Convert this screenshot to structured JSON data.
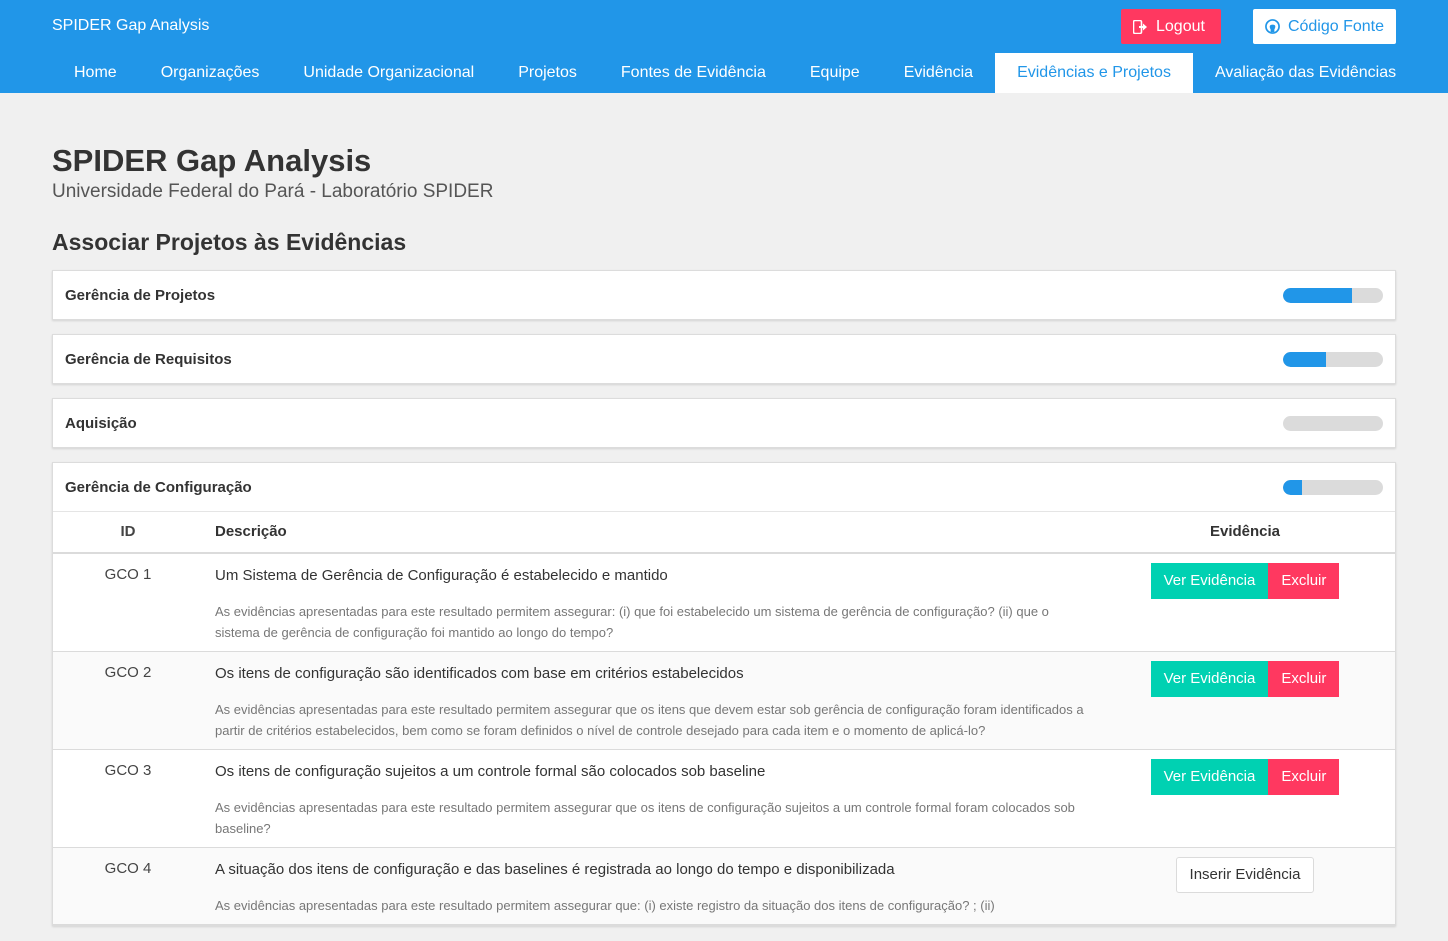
{
  "app": {
    "brand": "SPIDER Gap Analysis"
  },
  "header": {
    "logout_label": "Logout",
    "source_label": "Código Fonte"
  },
  "nav": {
    "tabs": [
      {
        "label": "Home"
      },
      {
        "label": "Organizações"
      },
      {
        "label": "Unidade Organizacional"
      },
      {
        "label": "Projetos"
      },
      {
        "label": "Fontes de Evidência"
      },
      {
        "label": "Equipe"
      },
      {
        "label": "Evidência"
      },
      {
        "label": "Evidências e Projetos",
        "active": true
      },
      {
        "label": "Avaliação das Evidências"
      }
    ]
  },
  "page": {
    "title": "SPIDER Gap Analysis",
    "subtitle": "Universidade Federal do Pará - Laboratório SPIDER",
    "section_title": "Associar Projetos às Evidências"
  },
  "panels": [
    {
      "title": "Gerência de Projetos",
      "progress": 0.69
    },
    {
      "title": "Gerência de Requisitos",
      "progress": 0.43
    },
    {
      "title": "Aquisição",
      "progress": 0.0
    },
    {
      "title": "Gerência de Configuração",
      "progress": 0.19
    }
  ],
  "table": {
    "headers": {
      "id": "ID",
      "description": "Descrição",
      "evidence": "Evidência"
    },
    "buttons": {
      "ver": "Ver Evidência",
      "excluir": "Excluir",
      "inserir": "Inserir Evidência"
    },
    "rows": [
      {
        "id": "GCO 1",
        "title": "Um Sistema de Gerência de Configuração é estabelecido e mantido",
        "text": "As evidências apresentadas para este resultado permitem assegurar: (i) que foi estabelecido um sistema de gerência de configuração? (ii) que o sistema de gerência de configuração foi mantido ao longo do tempo?",
        "has_evidence": true
      },
      {
        "id": "GCO 2",
        "title": "Os itens de configuração são identificados com base em critérios estabelecidos",
        "text": "As evidências apresentadas para este resultado permitem assegurar que os itens que devem estar sob gerência de configuração foram identificados a partir de critérios estabelecidos, bem como se foram definidos o nível de controle desejado para cada item e o momento de aplicá-lo?",
        "has_evidence": true
      },
      {
        "id": "GCO 3",
        "title": "Os itens de configuração sujeitos a um controle formal são colocados sob baseline",
        "text": "As evidências apresentadas para este resultado permitem assegurar que os itens de configuração sujeitos a um controle formal foram colocados sob baseline?",
        "has_evidence": true
      },
      {
        "id": "GCO 4",
        "title": "A situação dos itens de configuração e das baselines é registrada ao longo do tempo e disponibilizada",
        "text": "As evidências apresentadas para este resultado permitem assegurar que: (i) existe registro da situação dos itens de configuração? ; (ii)",
        "has_evidence": false
      }
    ]
  },
  "colors": {
    "primary": "#2196e8",
    "danger": "#ff3860",
    "success": "#00d1b2"
  }
}
